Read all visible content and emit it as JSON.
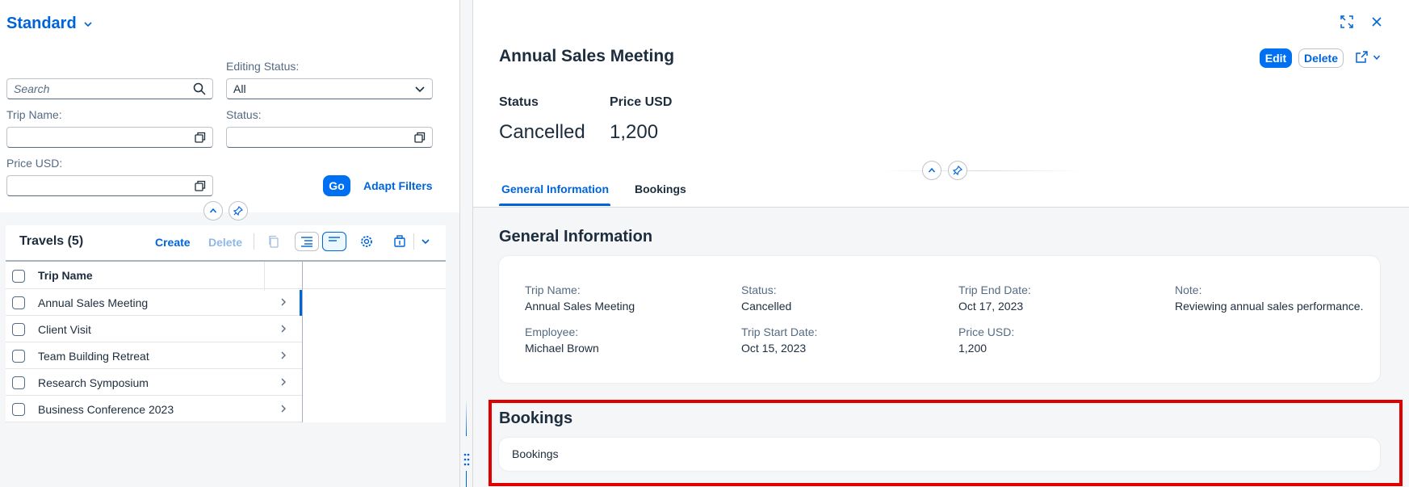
{
  "variant": {
    "title": "Standard"
  },
  "filters": {
    "search_placeholder": "Search",
    "editing_status_label": "Editing Status:",
    "editing_status_value": "All",
    "trip_name_label": "Trip Name:",
    "status_label": "Status:",
    "price_label": "Price USD:",
    "go_label": "Go",
    "adapt_label": "Adapt Filters"
  },
  "table": {
    "title": "Travels (5)",
    "create_label": "Create",
    "delete_label": "Delete",
    "column_header": "Trip Name",
    "rows": [
      "Annual Sales Meeting",
      "Client Visit",
      "Team Building Retreat",
      "Research Symposium",
      "Business Conference 2023"
    ]
  },
  "object": {
    "title": "Annual Sales Meeting",
    "edit_label": "Edit",
    "delete_label": "Delete",
    "kpis": [
      {
        "label": "Status",
        "value": "Cancelled"
      },
      {
        "label": "Price USD",
        "value": "1,200"
      }
    ],
    "tabs": [
      "General Information",
      "Bookings"
    ]
  },
  "general_info": {
    "section_title": "General Information",
    "fields": [
      {
        "label": "Trip Name:",
        "value": "Annual Sales Meeting"
      },
      {
        "label": "Status:",
        "value": "Cancelled"
      },
      {
        "label": "Trip End Date:",
        "value": "Oct 17, 2023"
      },
      {
        "label": "Note:",
        "value": "Reviewing annual sales performance."
      },
      {
        "label": "Employee:",
        "value": "Michael Brown"
      },
      {
        "label": "Trip Start Date:",
        "value": "Oct 15, 2023"
      },
      {
        "label": "Price USD:",
        "value": "1,200"
      }
    ]
  },
  "bookings": {
    "section_title": "Bookings",
    "card_text": "Bookings"
  },
  "colors": {
    "brand": "#0064d9",
    "emphasized_button": "#0070f2",
    "highlight": "#e00000"
  }
}
